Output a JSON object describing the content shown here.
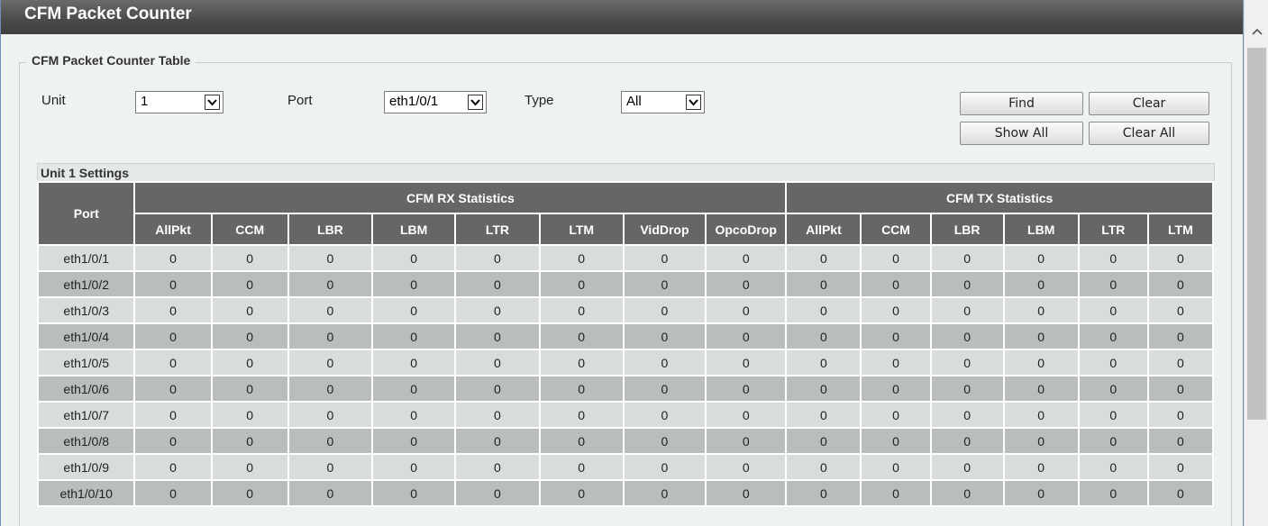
{
  "title": "CFM Packet Counter",
  "section_title": "CFM Packet Counter Table",
  "filters": {
    "unit_label": "Unit",
    "unit_value": "1",
    "port_label": "Port",
    "port_value": "eth1/0/1",
    "type_label": "Type",
    "type_value": "All"
  },
  "buttons": {
    "find": "Find",
    "clear": "Clear",
    "show_all": "Show All",
    "clear_all": "Clear All"
  },
  "settings_title": "Unit 1 Settings",
  "table": {
    "port_header": "Port",
    "rx_group": "CFM RX Statistics",
    "tx_group": "CFM TX Statistics",
    "rx_columns": [
      "AllPkt",
      "CCM",
      "LBR",
      "LBM",
      "LTR",
      "LTM",
      "VidDrop",
      "OpcoDrop"
    ],
    "tx_columns": [
      "AllPkt",
      "CCM",
      "LBR",
      "LBM",
      "LTR",
      "LTM"
    ],
    "rows": [
      {
        "port": "eth1/0/1",
        "values": [
          "0",
          "0",
          "0",
          "0",
          "0",
          "0",
          "0",
          "0",
          "0",
          "0",
          "0",
          "0",
          "0",
          "0"
        ]
      },
      {
        "port": "eth1/0/2",
        "values": [
          "0",
          "0",
          "0",
          "0",
          "0",
          "0",
          "0",
          "0",
          "0",
          "0",
          "0",
          "0",
          "0",
          "0"
        ]
      },
      {
        "port": "eth1/0/3",
        "values": [
          "0",
          "0",
          "0",
          "0",
          "0",
          "0",
          "0",
          "0",
          "0",
          "0",
          "0",
          "0",
          "0",
          "0"
        ]
      },
      {
        "port": "eth1/0/4",
        "values": [
          "0",
          "0",
          "0",
          "0",
          "0",
          "0",
          "0",
          "0",
          "0",
          "0",
          "0",
          "0",
          "0",
          "0"
        ]
      },
      {
        "port": "eth1/0/5",
        "values": [
          "0",
          "0",
          "0",
          "0",
          "0",
          "0",
          "0",
          "0",
          "0",
          "0",
          "0",
          "0",
          "0",
          "0"
        ]
      },
      {
        "port": "eth1/0/6",
        "values": [
          "0",
          "0",
          "0",
          "0",
          "0",
          "0",
          "0",
          "0",
          "0",
          "0",
          "0",
          "0",
          "0",
          "0"
        ]
      },
      {
        "port": "eth1/0/7",
        "values": [
          "0",
          "0",
          "0",
          "0",
          "0",
          "0",
          "0",
          "0",
          "0",
          "0",
          "0",
          "0",
          "0",
          "0"
        ]
      },
      {
        "port": "eth1/0/8",
        "values": [
          "0",
          "0",
          "0",
          "0",
          "0",
          "0",
          "0",
          "0",
          "0",
          "0",
          "0",
          "0",
          "0",
          "0"
        ]
      },
      {
        "port": "eth1/0/9",
        "values": [
          "0",
          "0",
          "0",
          "0",
          "0",
          "0",
          "0",
          "0",
          "0",
          "0",
          "0",
          "0",
          "0",
          "0"
        ]
      },
      {
        "port": "eth1/0/10",
        "values": [
          "0",
          "0",
          "0",
          "0",
          "0",
          "0",
          "0",
          "0",
          "0",
          "0",
          "0",
          "0",
          "0",
          "0"
        ]
      }
    ]
  }
}
